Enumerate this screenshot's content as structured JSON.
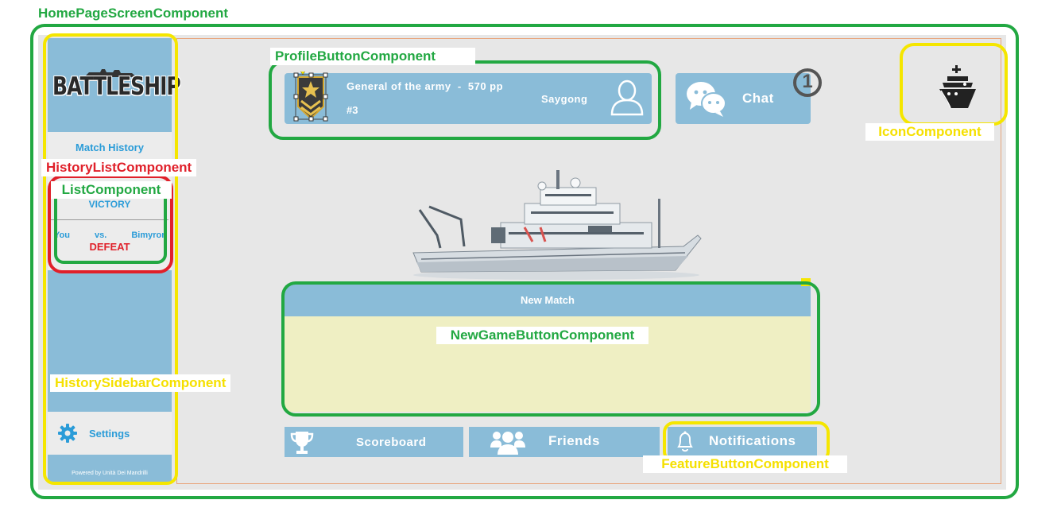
{
  "annotations": {
    "home_page_screen": "HomePageScreenComponent",
    "profile_button": "ProfileButtonComponent",
    "icon": "IconComponent",
    "history_list": "HistoryListComponent",
    "list": "ListComponent",
    "history_sidebar": "HistorySidebarComponent",
    "new_game_button": "NewGameButtonComponent",
    "feature_button": "FeatureButtonComponent"
  },
  "sidebar": {
    "logo": "BATTLESHIP",
    "history_title": "Match History",
    "matches": [
      {
        "result": "VICTORY"
      },
      {
        "player": "You",
        "vs": "vs.",
        "opponent": "Bimyron",
        "result": "DEFEAT"
      }
    ],
    "settings_label": "Settings",
    "powered_by": "Powered by Unità Dei Mandrilli"
  },
  "profile": {
    "rank_line": "General of the army  -  570 pp",
    "position": "#3",
    "username": "Saygong"
  },
  "chat": {
    "label": "Chat",
    "unread": "1"
  },
  "new_match": {
    "label": "New Match"
  },
  "features": {
    "scoreboard": "Scoreboard",
    "friends": "Friends",
    "notifications": "Notifications"
  },
  "colors": {
    "panel_blue": "#8abcd8",
    "link_blue": "#2b9cd8",
    "defeat_red": "#e0202a",
    "new_match_body": "#efefc3",
    "annotation_green": "#22a842",
    "annotation_yellow": "#f5e600",
    "annotation_red": "#e0202a"
  }
}
